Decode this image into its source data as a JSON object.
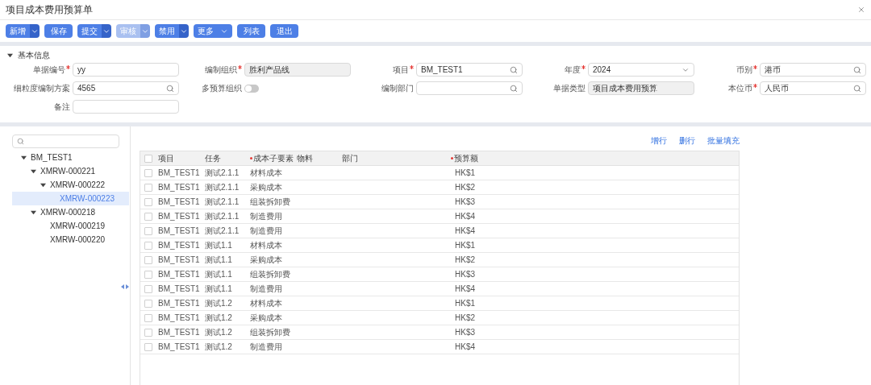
{
  "window": {
    "title": "项目成本费用预算单"
  },
  "toolbar": [
    {
      "label": "新增",
      "kind": "split",
      "disabled": false
    },
    {
      "label": "保存",
      "kind": "plain",
      "disabled": false
    },
    {
      "label": "提交",
      "kind": "split",
      "disabled": false
    },
    {
      "label": "审核",
      "kind": "split",
      "disabled": true
    },
    {
      "label": "禁用",
      "kind": "split",
      "disabled": false
    },
    {
      "label": "更多",
      "kind": "menu",
      "disabled": false
    },
    {
      "label": "列表",
      "kind": "plain",
      "disabled": false
    },
    {
      "label": "退出",
      "kind": "plain",
      "disabled": false
    }
  ],
  "section": {
    "title": "基本信息",
    "expanded": true,
    "rows": [
      [
        {
          "label": "单据编号",
          "required": true,
          "kind": "text",
          "value": "yy"
        },
        {
          "label": "编制组织",
          "required": true,
          "kind": "readonly",
          "value": "胜利产品线"
        },
        {
          "label": "项目",
          "required": true,
          "kind": "lookup",
          "value": "BM_TEST1"
        },
        {
          "label": "年度",
          "required": true,
          "kind": "select",
          "value": "2024"
        },
        {
          "label": "币别",
          "required": true,
          "kind": "lookup",
          "value": "港币"
        }
      ],
      [
        {
          "label": "细粒度编制方案",
          "required": false,
          "kind": "lookup",
          "value": "4565"
        },
        {
          "label": "多预算组织",
          "required": false,
          "kind": "toggle",
          "on": false
        },
        {
          "label": "编制部门",
          "required": false,
          "kind": "lookup"
        },
        {
          "label": "单据类型",
          "required": false,
          "kind": "readonly",
          "value": "项目成本费用预算"
        },
        {
          "label": "本位币",
          "required": true,
          "kind": "lookup",
          "value": "人民币"
        }
      ],
      [
        {
          "label": "备注",
          "required": false,
          "kind": "text"
        }
      ]
    ]
  },
  "tree": {
    "items": [
      {
        "label": "BM_TEST1",
        "expanded": true,
        "selected": false,
        "children": [
          {
            "label": "XMRW-000221",
            "expanded": true,
            "selected": false,
            "children": [
              {
                "label": "XMRW-000222",
                "expanded": true,
                "selected": false,
                "children": [
                  {
                    "label": "XMRW-000223",
                    "selected": true
                  }
                ]
              }
            ]
          },
          {
            "label": "XMRW-000218",
            "expanded": true,
            "selected": false,
            "children": [
              {
                "label": "XMRW-000219",
                "selected": false
              },
              {
                "label": "XMRW-000220",
                "selected": false
              }
            ]
          }
        ]
      }
    ]
  },
  "table_actions": [
    "增行",
    "删行",
    "批量填充"
  ],
  "table": {
    "header_checked": false,
    "columns": [
      {
        "label": "项目",
        "required": false
      },
      {
        "label": "任务",
        "required": false
      },
      {
        "label": "成本子要素",
        "required": true
      },
      {
        "label": "物料",
        "required": false
      },
      {
        "label": "部门",
        "required": false
      },
      {
        "label": "预算额",
        "required": true
      }
    ],
    "rows": [
      {
        "checked": false,
        "project": "BM_TEST1",
        "task": "测试2.1.1",
        "cost_element": "材料成本",
        "amount": "HK$1"
      },
      {
        "checked": false,
        "project": "BM_TEST1",
        "task": "测试2.1.1",
        "cost_element": "采购成本",
        "amount": "HK$2"
      },
      {
        "checked": false,
        "project": "BM_TEST1",
        "task": "测试2.1.1",
        "cost_element": "组装拆卸费",
        "amount": "HK$3"
      },
      {
        "checked": false,
        "project": "BM_TEST1",
        "task": "测试2.1.1",
        "cost_element": "制造费用",
        "amount": "HK$4"
      },
      {
        "checked": false,
        "project": "BM_TEST1",
        "task": "测试2.1.1",
        "cost_element": "制造费用",
        "amount": "HK$4"
      },
      {
        "checked": false,
        "project": "BM_TEST1",
        "task": "测试1.1",
        "cost_element": "材料成本",
        "amount": "HK$1"
      },
      {
        "checked": false,
        "project": "BM_TEST1",
        "task": "测试1.1",
        "cost_element": "采购成本",
        "amount": "HK$2"
      },
      {
        "checked": false,
        "project": "BM_TEST1",
        "task": "测试1.1",
        "cost_element": "组装拆卸费",
        "amount": "HK$3"
      },
      {
        "checked": false,
        "project": "BM_TEST1",
        "task": "测试1.1",
        "cost_element": "制造费用",
        "amount": "HK$4"
      },
      {
        "checked": false,
        "project": "BM_TEST1",
        "task": "测试1.2",
        "cost_element": "材料成本",
        "amount": "HK$1"
      },
      {
        "checked": false,
        "project": "BM_TEST1",
        "task": "测试1.2",
        "cost_element": "采购成本",
        "amount": "HK$2"
      },
      {
        "checked": false,
        "project": "BM_TEST1",
        "task": "测试1.2",
        "cost_element": "组装拆卸费",
        "amount": "HK$3"
      },
      {
        "checked": false,
        "project": "BM_TEST1",
        "task": "测试1.2",
        "cost_element": "制造费用",
        "amount": "HK$4"
      }
    ]
  }
}
